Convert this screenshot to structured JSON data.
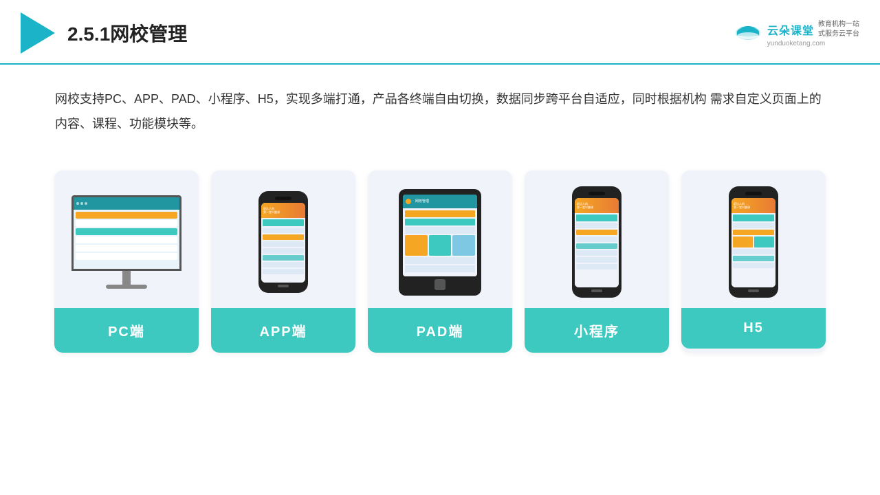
{
  "header": {
    "title": "2.5.1网校管理",
    "brand_name": "云朵课堂",
    "brand_url": "yunduoketang.com",
    "brand_tagline": "教育机构一站\n式服务云平台"
  },
  "description": "网校支持PC、APP、PAD、小程序、H5，实现多端打通，产品各终端自由切换，数据同步跨平台自适应，同时根据机构\n需求自定义页面上的内容、课程、功能模块等。",
  "cards": [
    {
      "id": "pc",
      "label": "PC端"
    },
    {
      "id": "app",
      "label": "APP端"
    },
    {
      "id": "pad",
      "label": "PAD端"
    },
    {
      "id": "miniapp",
      "label": "小程序"
    },
    {
      "id": "h5",
      "label": "H5"
    }
  ],
  "colors": {
    "teal": "#3dc8c0",
    "accent": "#1ab3c8",
    "card_bg": "#f0f4fa"
  }
}
